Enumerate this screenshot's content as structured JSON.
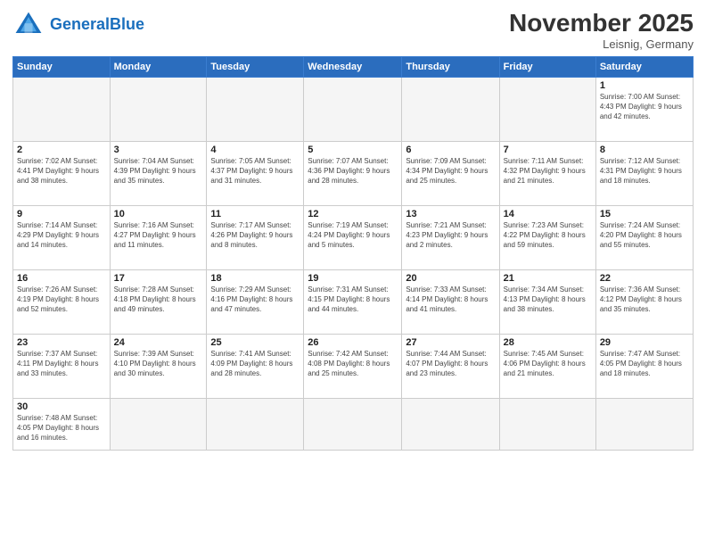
{
  "header": {
    "logo_general": "General",
    "logo_blue": "Blue",
    "month_title": "November 2025",
    "location": "Leisnig, Germany"
  },
  "weekdays": [
    "Sunday",
    "Monday",
    "Tuesday",
    "Wednesday",
    "Thursday",
    "Friday",
    "Saturday"
  ],
  "weeks": [
    [
      {
        "day": "",
        "info": ""
      },
      {
        "day": "",
        "info": ""
      },
      {
        "day": "",
        "info": ""
      },
      {
        "day": "",
        "info": ""
      },
      {
        "day": "",
        "info": ""
      },
      {
        "day": "",
        "info": ""
      },
      {
        "day": "1",
        "info": "Sunrise: 7:00 AM\nSunset: 4:43 PM\nDaylight: 9 hours\nand 42 minutes."
      }
    ],
    [
      {
        "day": "2",
        "info": "Sunrise: 7:02 AM\nSunset: 4:41 PM\nDaylight: 9 hours\nand 38 minutes."
      },
      {
        "day": "3",
        "info": "Sunrise: 7:04 AM\nSunset: 4:39 PM\nDaylight: 9 hours\nand 35 minutes."
      },
      {
        "day": "4",
        "info": "Sunrise: 7:05 AM\nSunset: 4:37 PM\nDaylight: 9 hours\nand 31 minutes."
      },
      {
        "day": "5",
        "info": "Sunrise: 7:07 AM\nSunset: 4:36 PM\nDaylight: 9 hours\nand 28 minutes."
      },
      {
        "day": "6",
        "info": "Sunrise: 7:09 AM\nSunset: 4:34 PM\nDaylight: 9 hours\nand 25 minutes."
      },
      {
        "day": "7",
        "info": "Sunrise: 7:11 AM\nSunset: 4:32 PM\nDaylight: 9 hours\nand 21 minutes."
      },
      {
        "day": "8",
        "info": "Sunrise: 7:12 AM\nSunset: 4:31 PM\nDaylight: 9 hours\nand 18 minutes."
      }
    ],
    [
      {
        "day": "9",
        "info": "Sunrise: 7:14 AM\nSunset: 4:29 PM\nDaylight: 9 hours\nand 14 minutes."
      },
      {
        "day": "10",
        "info": "Sunrise: 7:16 AM\nSunset: 4:27 PM\nDaylight: 9 hours\nand 11 minutes."
      },
      {
        "day": "11",
        "info": "Sunrise: 7:17 AM\nSunset: 4:26 PM\nDaylight: 9 hours\nand 8 minutes."
      },
      {
        "day": "12",
        "info": "Sunrise: 7:19 AM\nSunset: 4:24 PM\nDaylight: 9 hours\nand 5 minutes."
      },
      {
        "day": "13",
        "info": "Sunrise: 7:21 AM\nSunset: 4:23 PM\nDaylight: 9 hours\nand 2 minutes."
      },
      {
        "day": "14",
        "info": "Sunrise: 7:23 AM\nSunset: 4:22 PM\nDaylight: 8 hours\nand 59 minutes."
      },
      {
        "day": "15",
        "info": "Sunrise: 7:24 AM\nSunset: 4:20 PM\nDaylight: 8 hours\nand 55 minutes."
      }
    ],
    [
      {
        "day": "16",
        "info": "Sunrise: 7:26 AM\nSunset: 4:19 PM\nDaylight: 8 hours\nand 52 minutes."
      },
      {
        "day": "17",
        "info": "Sunrise: 7:28 AM\nSunset: 4:18 PM\nDaylight: 8 hours\nand 49 minutes."
      },
      {
        "day": "18",
        "info": "Sunrise: 7:29 AM\nSunset: 4:16 PM\nDaylight: 8 hours\nand 47 minutes."
      },
      {
        "day": "19",
        "info": "Sunrise: 7:31 AM\nSunset: 4:15 PM\nDaylight: 8 hours\nand 44 minutes."
      },
      {
        "day": "20",
        "info": "Sunrise: 7:33 AM\nSunset: 4:14 PM\nDaylight: 8 hours\nand 41 minutes."
      },
      {
        "day": "21",
        "info": "Sunrise: 7:34 AM\nSunset: 4:13 PM\nDaylight: 8 hours\nand 38 minutes."
      },
      {
        "day": "22",
        "info": "Sunrise: 7:36 AM\nSunset: 4:12 PM\nDaylight: 8 hours\nand 35 minutes."
      }
    ],
    [
      {
        "day": "23",
        "info": "Sunrise: 7:37 AM\nSunset: 4:11 PM\nDaylight: 8 hours\nand 33 minutes."
      },
      {
        "day": "24",
        "info": "Sunrise: 7:39 AM\nSunset: 4:10 PM\nDaylight: 8 hours\nand 30 minutes."
      },
      {
        "day": "25",
        "info": "Sunrise: 7:41 AM\nSunset: 4:09 PM\nDaylight: 8 hours\nand 28 minutes."
      },
      {
        "day": "26",
        "info": "Sunrise: 7:42 AM\nSunset: 4:08 PM\nDaylight: 8 hours\nand 25 minutes."
      },
      {
        "day": "27",
        "info": "Sunrise: 7:44 AM\nSunset: 4:07 PM\nDaylight: 8 hours\nand 23 minutes."
      },
      {
        "day": "28",
        "info": "Sunrise: 7:45 AM\nSunset: 4:06 PM\nDaylight: 8 hours\nand 21 minutes."
      },
      {
        "day": "29",
        "info": "Sunrise: 7:47 AM\nSunset: 4:05 PM\nDaylight: 8 hours\nand 18 minutes."
      }
    ],
    [
      {
        "day": "30",
        "info": "Sunrise: 7:48 AM\nSunset: 4:05 PM\nDaylight: 8 hours\nand 16 minutes."
      },
      {
        "day": "",
        "info": ""
      },
      {
        "day": "",
        "info": ""
      },
      {
        "day": "",
        "info": ""
      },
      {
        "day": "",
        "info": ""
      },
      {
        "day": "",
        "info": ""
      },
      {
        "day": "",
        "info": ""
      }
    ]
  ]
}
